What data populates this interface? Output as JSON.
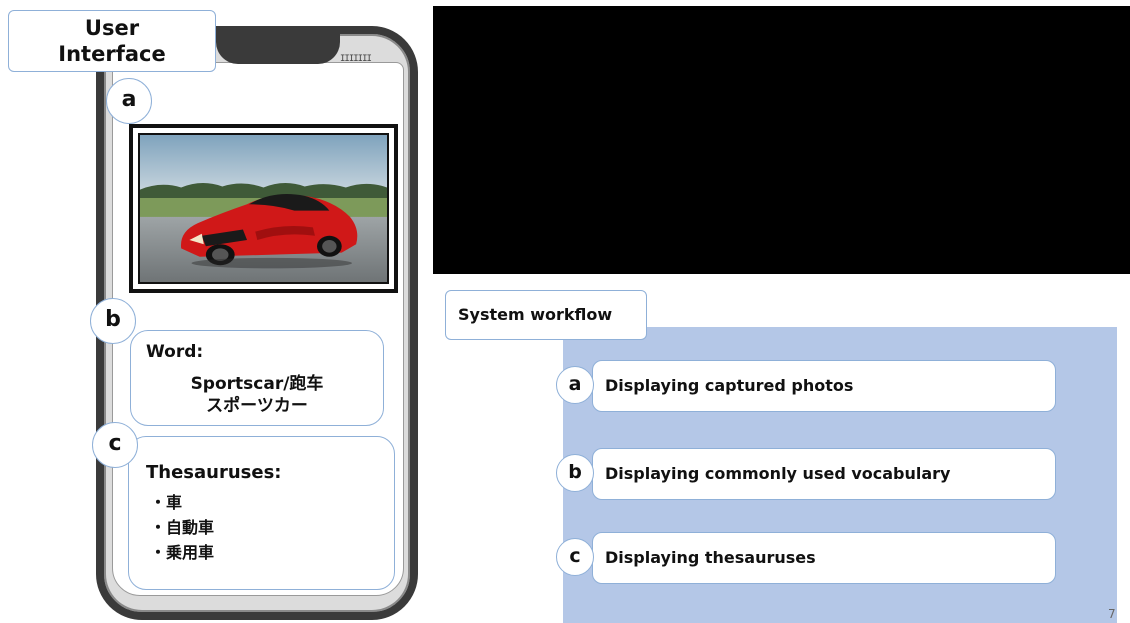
{
  "ui_section": {
    "title_line1": "User",
    "title_line2": "Interface",
    "signal_indicator": "IIIIIII"
  },
  "labels": {
    "a": "a",
    "b": "b",
    "c": "c"
  },
  "word_panel": {
    "label": "Word:",
    "line1": "Sportscar/跑车",
    "line2": "スポーツカー"
  },
  "thesaurus_panel": {
    "label": "Thesauruses:",
    "items": [
      "・車",
      "・自動車",
      "・乗用車"
    ]
  },
  "workflow": {
    "title": "System workflow",
    "steps": [
      {
        "label": "a",
        "text": "Displaying captured photos"
      },
      {
        "label": "b",
        "text": "Displaying commonly used vocabulary"
      },
      {
        "label": "c",
        "text": "Displaying thesauruses"
      }
    ]
  },
  "footer": {
    "page_number": "7"
  },
  "colors": {
    "accent_border": "#8fb0d8",
    "workflow_panel": "#b4c7e7",
    "phone_frame": "#3a3a3a",
    "car_red": "#d01818"
  },
  "icons": {
    "photo": "sports-car-photo"
  }
}
